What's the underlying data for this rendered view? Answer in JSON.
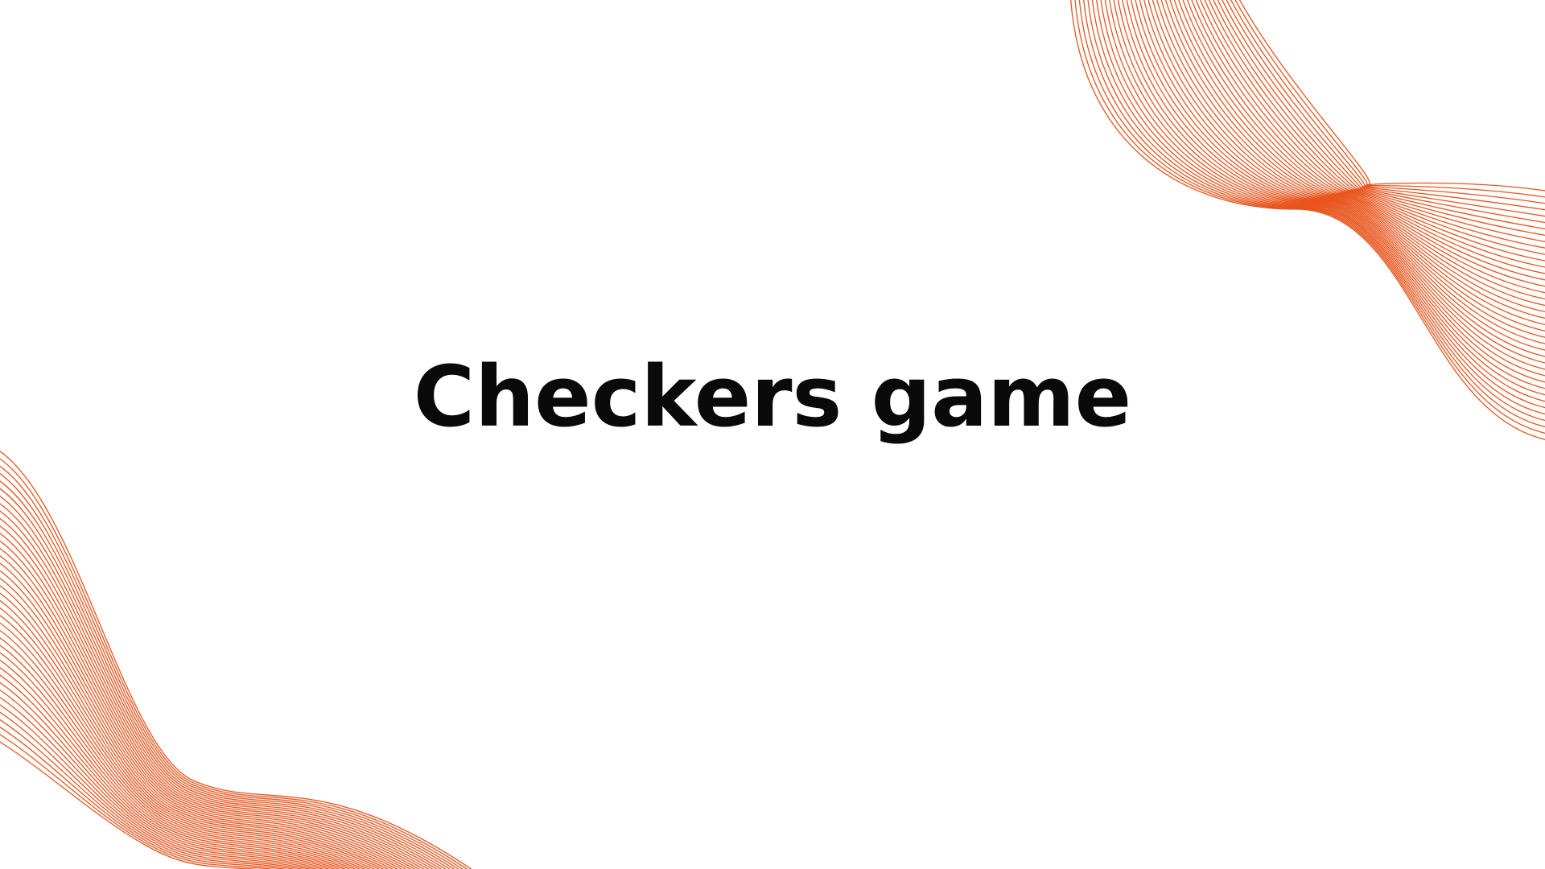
{
  "slide": {
    "title": "Checkers game"
  },
  "decoration": {
    "top_right": {
      "name": "orange-wave-lines",
      "color": "#E8541C",
      "line_count": 40
    },
    "bottom_left": {
      "name": "orange-wave-lines",
      "color": "#E8541C",
      "line_count": 40
    }
  }
}
